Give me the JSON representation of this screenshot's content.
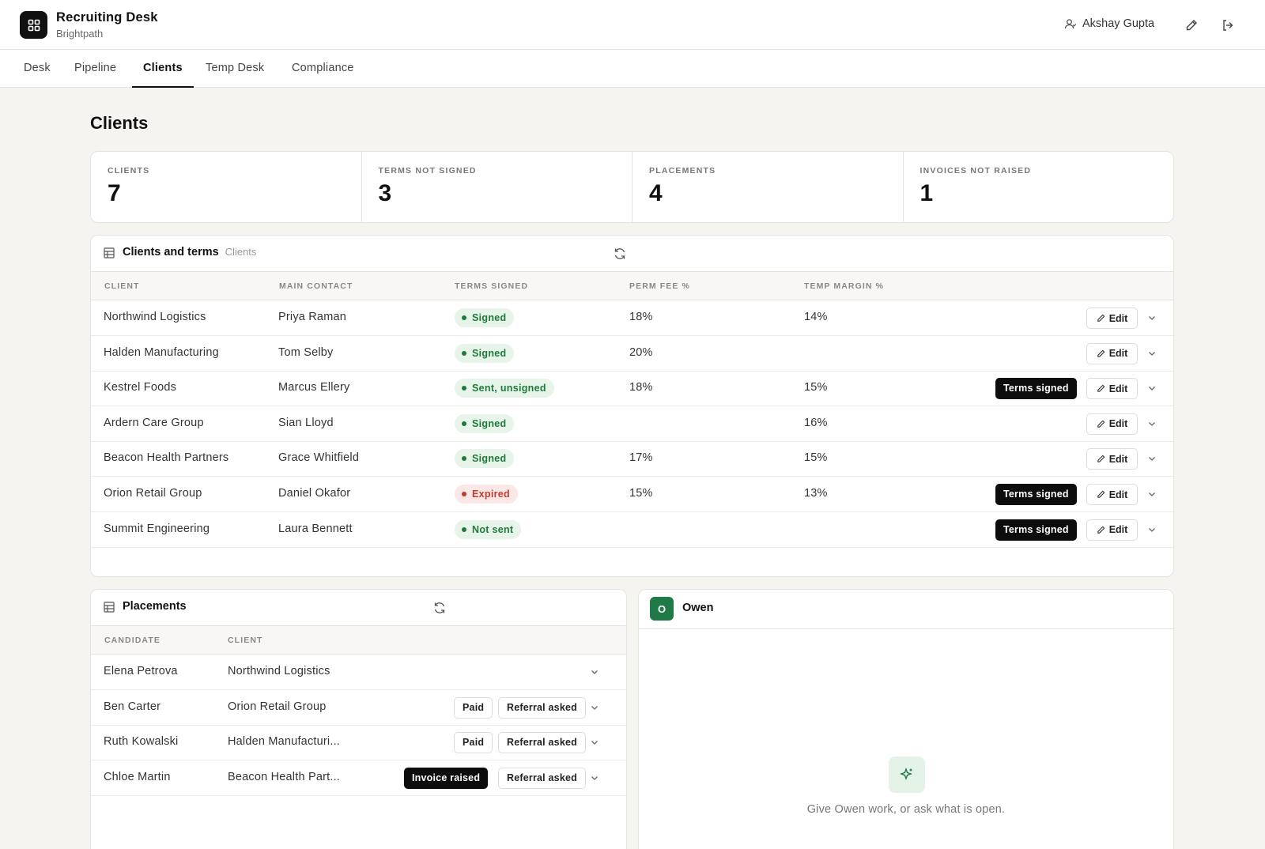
{
  "app": {
    "title": "Recruiting Desk",
    "subtitle": "Brightpath"
  },
  "user": {
    "name": "Akshay Gupta"
  },
  "icons": {
    "logo": "grid-logo-icon",
    "user": "user-icon",
    "edit": "pencil-icon",
    "logout": "logout-icon",
    "table": "table-icon",
    "refresh": "refresh-icon",
    "chevron": "chevron-down-icon",
    "spark": "sparkle-icon"
  },
  "tabs": [
    {
      "label": "Desk"
    },
    {
      "label": "Pipeline"
    },
    {
      "label": "Clients"
    },
    {
      "label": "Temp Desk"
    },
    {
      "label": "Compliance"
    }
  ],
  "page": {
    "title": "Clients"
  },
  "stats": [
    {
      "label": "CLIENTS",
      "value": "7"
    },
    {
      "label": "TERMS NOT SIGNED",
      "value": "3"
    },
    {
      "label": "PLACEMENTS",
      "value": "4"
    },
    {
      "label": "INVOICES NOT RAISED",
      "value": "1"
    }
  ],
  "clients_table": {
    "title": "Clients and terms",
    "subtitle": "Clients",
    "columns": [
      "CLIENT",
      "MAIN CONTACT",
      "TERMS SIGNED",
      "PERM FEE %",
      "TEMP MARGIN %"
    ],
    "edit_label": "Edit",
    "terms_signed_label": "Terms signed",
    "rows": [
      {
        "client": "Northwind Logistics",
        "contact": "Priya Raman",
        "status": "Signed",
        "perm": "18%",
        "temp": "14%"
      },
      {
        "client": "Halden Manufacturing",
        "contact": "Tom Selby",
        "status": "Signed",
        "perm": "20%",
        "temp": ""
      },
      {
        "client": "Kestrel Foods",
        "contact": "Marcus Ellery",
        "status": "Sent, unsigned",
        "perm": "18%",
        "temp": "15%"
      },
      {
        "client": "Ardern Care Group",
        "contact": "Sian Lloyd",
        "status": "Signed",
        "perm": "",
        "temp": "16%"
      },
      {
        "client": "Beacon Health Partners",
        "contact": "Grace Whitfield",
        "status": "Signed",
        "perm": "17%",
        "temp": "15%"
      },
      {
        "client": "Orion Retail Group",
        "contact": "Daniel Okafor",
        "status": "Expired",
        "perm": "15%",
        "temp": "13%"
      },
      {
        "client": "Summit Engineering",
        "contact": "Laura Bennett",
        "status": "Not sent",
        "perm": "",
        "temp": ""
      }
    ]
  },
  "placements": {
    "title": "Placements",
    "columns": [
      "CANDIDATE",
      "CLIENT"
    ],
    "paid_label": "Paid",
    "referral_label": "Referral asked",
    "invoice_label": "Invoice raised",
    "rows": [
      {
        "candidate": "Elena Petrova",
        "client": "Northwind Logistics"
      },
      {
        "candidate": "Ben Carter",
        "client": "Orion Retail Group"
      },
      {
        "candidate": "Ruth Kowalski",
        "client": "Halden Manufacturi..."
      },
      {
        "candidate": "Chloe Martin",
        "client": "Beacon Health Part..."
      }
    ]
  },
  "assistant": {
    "initial": "O",
    "name": "Owen",
    "empty_message": "Give Owen work, or ask what is open."
  },
  "colors": {
    "signed": "#1f7a3a",
    "expired": "#c23a2c",
    "accent_dark": "#0d0d0d",
    "owen": "#1f7a47"
  }
}
